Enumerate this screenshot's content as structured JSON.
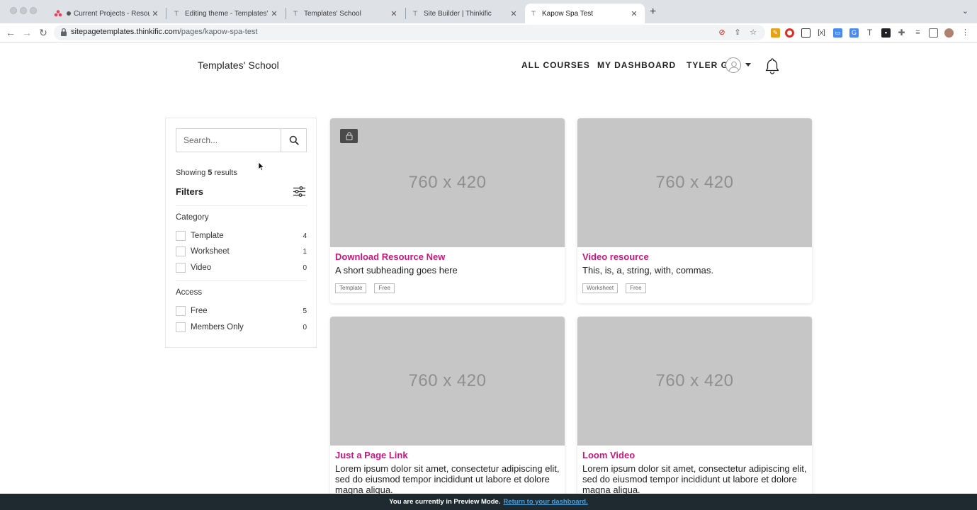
{
  "browser": {
    "tabs": [
      {
        "title": "Current Projects - Resource",
        "active": false
      },
      {
        "title": "Editing theme - Templates' Sch",
        "active": false
      },
      {
        "title": "Templates' School",
        "active": false
      },
      {
        "title": "Site Builder | Thinkific",
        "active": false
      },
      {
        "title": "Kapow Spa Test",
        "active": true
      }
    ],
    "url_host": "sitepagetemplates.thinkific.com",
    "url_path": "/pages/kapow-spa-test"
  },
  "header": {
    "school_name": "Templates' School",
    "nav": {
      "all_courses": "ALL COURSES",
      "my_dashboard": "MY DASHBOARD",
      "user": "TYLER G"
    }
  },
  "sidebar": {
    "search_placeholder": "Search...",
    "showing_prefix": "Showing",
    "showing_count": "5",
    "showing_suffix": "results",
    "filters_title": "Filters",
    "category": {
      "title": "Category",
      "options": [
        {
          "label": "Template",
          "count": "4"
        },
        {
          "label": "Worksheet",
          "count": "1"
        },
        {
          "label": "Video",
          "count": "0"
        }
      ]
    },
    "access": {
      "title": "Access",
      "options": [
        {
          "label": "Free",
          "count": "5"
        },
        {
          "label": "Members Only",
          "count": "0"
        }
      ]
    }
  },
  "cards": [
    {
      "placeholder": "760 x 420",
      "locked": true,
      "title": "Download Resource New",
      "subtitle": "A short subheading goes here",
      "tags": [
        "Template",
        "Free"
      ]
    },
    {
      "placeholder": "760 x 420",
      "locked": false,
      "title": "Video resource",
      "subtitle": "This, is, a, string, with, commas.",
      "tags": [
        "Worksheet",
        "Free"
      ]
    },
    {
      "placeholder": "760 x 420",
      "locked": false,
      "title": "Just a Page Link",
      "subtitle": "Lorem ipsum dolor sit amet, consectetur adipiscing elit, sed do eiusmod tempor incididunt ut labore et dolore magna aliqua.",
      "tags": []
    },
    {
      "placeholder": "760 x 420",
      "locked": false,
      "title": "Loom Video",
      "subtitle": "Lorem ipsum dolor sit amet, consectetur adipiscing elit, sed do eiusmod tempor incididunt ut labore et dolore magna aliqua.",
      "tags": []
    }
  ],
  "preview_bar": {
    "message": "You are currently in Preview Mode.",
    "link": "Return to your dashboard."
  },
  "colors": {
    "accent": "#c6187c",
    "preview_bar": "#1f2a30",
    "link": "#4a9fd8"
  }
}
